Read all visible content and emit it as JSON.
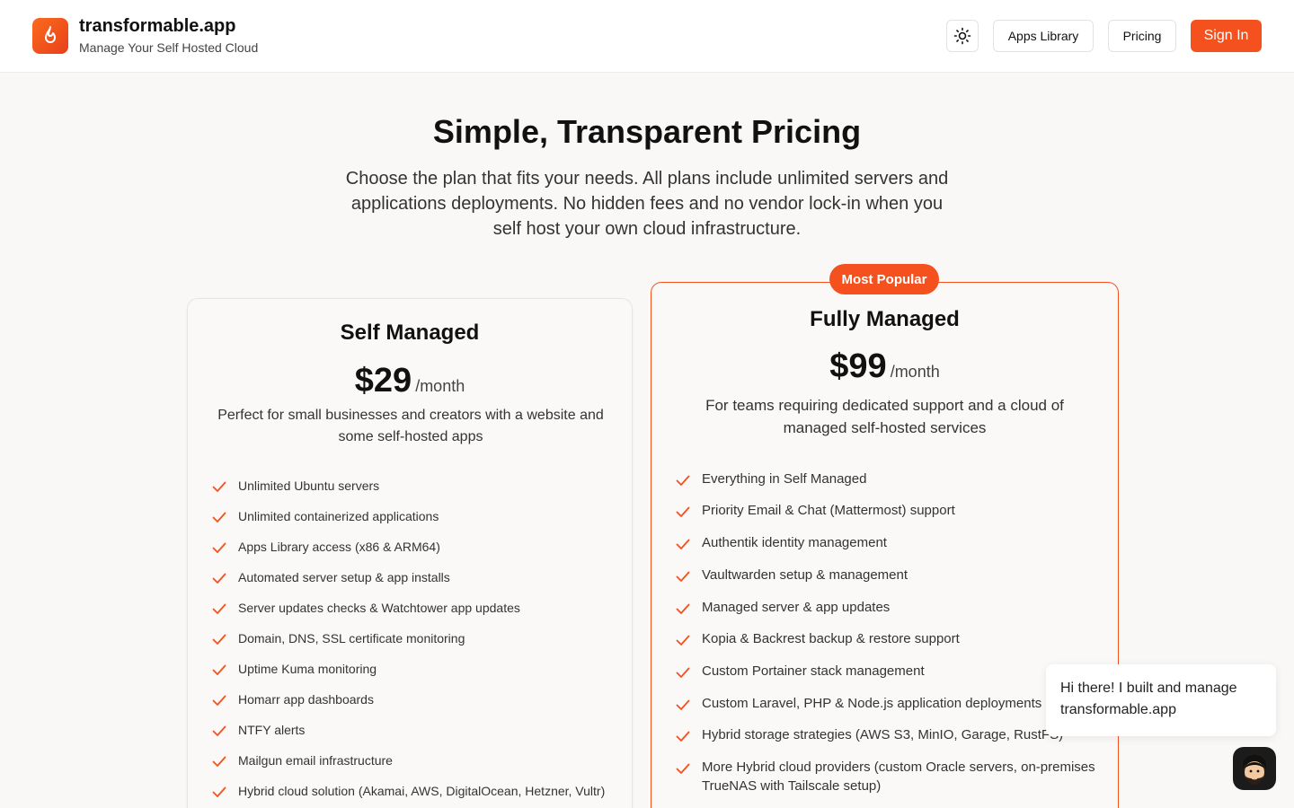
{
  "header": {
    "brand_title": "transformable.app",
    "brand_subtitle": "Manage Your Self Hosted Cloud",
    "theme_icon": "sun-icon",
    "nav": {
      "apps_library": "Apps Library",
      "pricing": "Pricing",
      "sign_in": "Sign In"
    }
  },
  "hero": {
    "title": "Simple, Transparent Pricing",
    "description": "Choose the plan that fits your needs. All plans include unlimited servers and applications deployments. No hidden fees and no vendor lock-in when you self host your own cloud infrastructure."
  },
  "plans": {
    "self_managed": {
      "name": "Self Managed",
      "price": "$29",
      "period": "/month",
      "description": "Perfect for small businesses and creators with a website and some self-hosted apps",
      "features": [
        "Unlimited Ubuntu servers",
        "Unlimited containerized applications",
        "Apps Library access (x86 & ARM64)",
        "Automated server setup & app installs",
        "Server updates checks & Watchtower app updates",
        "Domain, DNS, SSL certificate monitoring",
        "Uptime Kuma monitoring",
        "Homarr app dashboards",
        "NTFY alerts",
        "Mailgun email infrastructure",
        "Hybrid cloud solution (Akamai, AWS, DigitalOcean, Hetzner, Vultr)"
      ]
    },
    "fully_managed": {
      "badge": "Most Popular",
      "name": "Fully Managed",
      "price": "$99",
      "period": "/month",
      "description": "For teams requiring dedicated support and a cloud of managed self-hosted services",
      "features": [
        "Everything in Self Managed",
        "Priority Email & Chat (Mattermost) support",
        "Authentik identity management",
        "Vaultwarden setup & management",
        "Managed server & app updates",
        "Kopia & Backrest backup & restore support",
        "Custom Portainer stack management",
        "Custom Laravel, PHP & Node.js application deployments",
        "Hybrid storage strategies (AWS S3, MinIO, Garage, RustFS)",
        "More Hybrid cloud providers (custom Oracle servers, on-premises TrueNAS with Tailscale setup)"
      ]
    }
  },
  "chat": {
    "message": "Hi there! I built and manage transformable.app"
  },
  "colors": {
    "accent": "#f4511e",
    "background": "#faf8f6",
    "check": "#f4511e"
  }
}
